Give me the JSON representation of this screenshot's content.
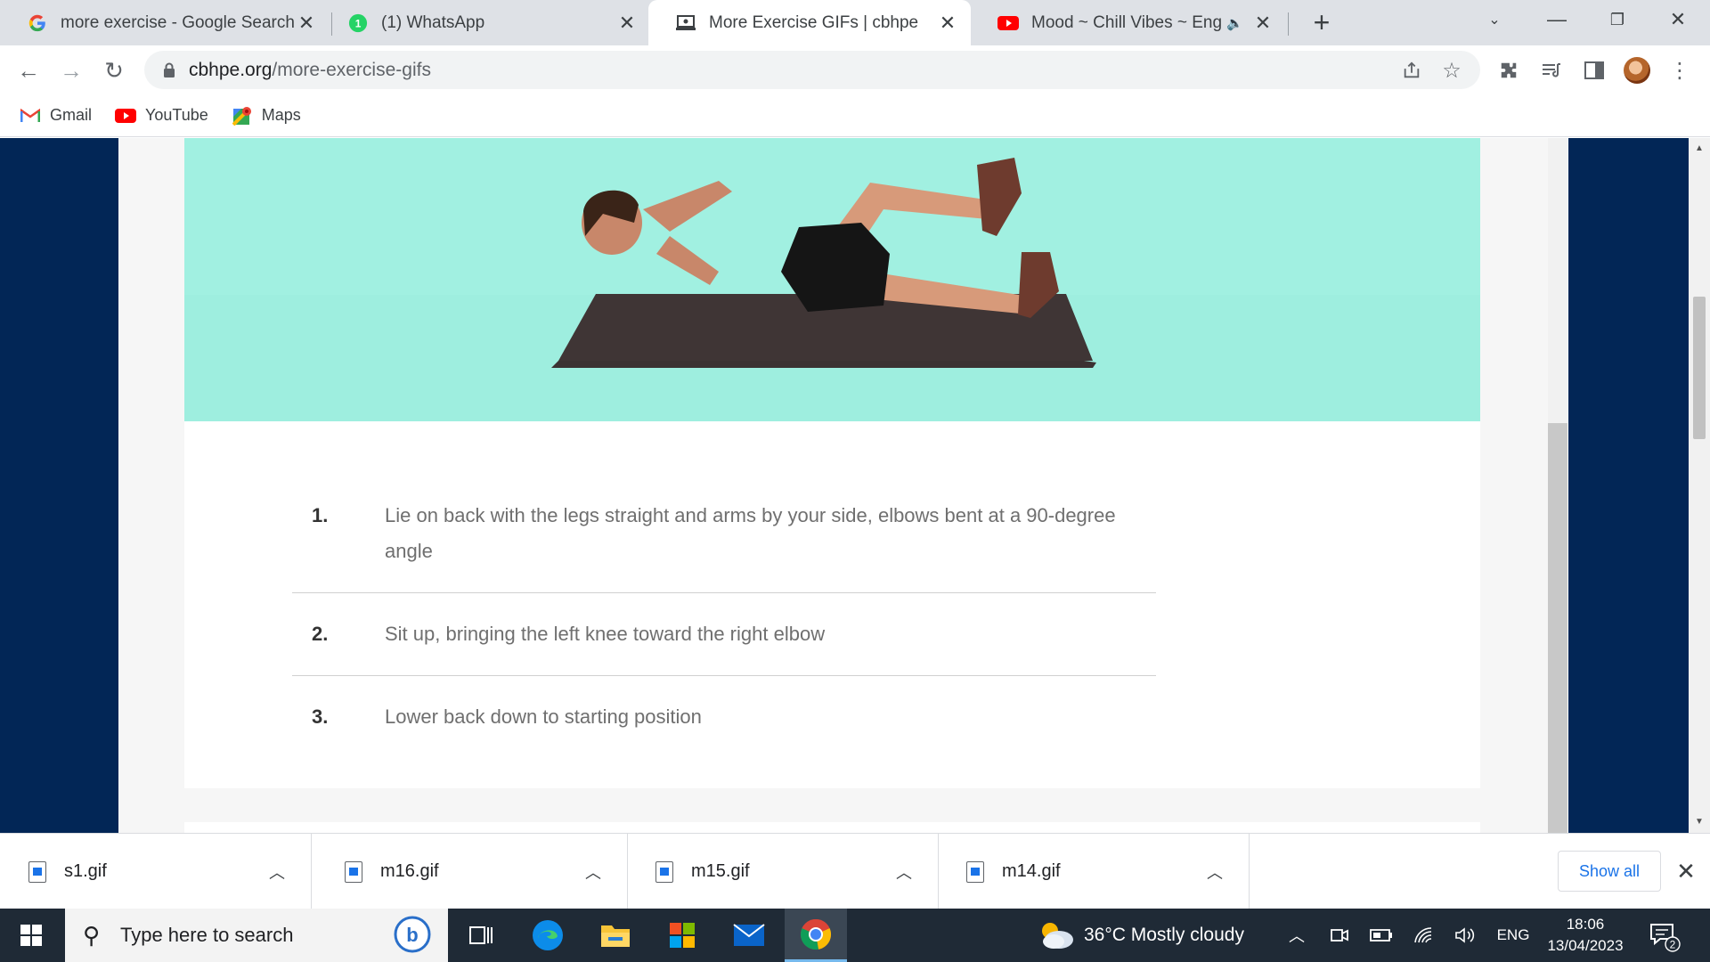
{
  "tabs": [
    {
      "title": "more exercise - Google Search",
      "icon": "google-icon"
    },
    {
      "title": "(1) WhatsApp",
      "icon": "whatsapp-icon",
      "badge": "1"
    },
    {
      "title": "More Exercise GIFs | cbhpe",
      "icon": "laptop-icon",
      "active": true
    },
    {
      "title": "Mood ~ Chill Vibes ~ English",
      "icon": "youtube-icon"
    }
  ],
  "address": {
    "domain": "cbhpe.org",
    "path": "/more-exercise-gifs"
  },
  "bookmarks": [
    {
      "label": "Gmail",
      "icon": "gmail-icon"
    },
    {
      "label": "YouTube",
      "icon": "youtube-icon"
    },
    {
      "label": "Maps",
      "icon": "maps-icon"
    }
  ],
  "steps": [
    {
      "num": "1.",
      "text": "Lie on back with the legs straight and arms by your side, elbows bent at a 90-degree angle"
    },
    {
      "num": "2.",
      "text": "Sit up, bringing the left knee toward the right elbow"
    },
    {
      "num": "3.",
      "text": "Lower back down to starting position"
    }
  ],
  "downloads": [
    {
      "name": "s1.gif"
    },
    {
      "name": "m16.gif"
    },
    {
      "name": "m15.gif"
    },
    {
      "name": "m14.gif"
    }
  ],
  "downloads_show_all": "Show all",
  "taskbar": {
    "search_placeholder": "Type here to search",
    "weather": "36°C  Mostly cloudy",
    "language": "ENG",
    "time": "18:06",
    "date": "13/04/2023",
    "notifications": "2"
  },
  "colors": {
    "side_navy": "#022656",
    "gif_bg": "#a1f0e1",
    "accent_blue": "#1a73e8"
  }
}
